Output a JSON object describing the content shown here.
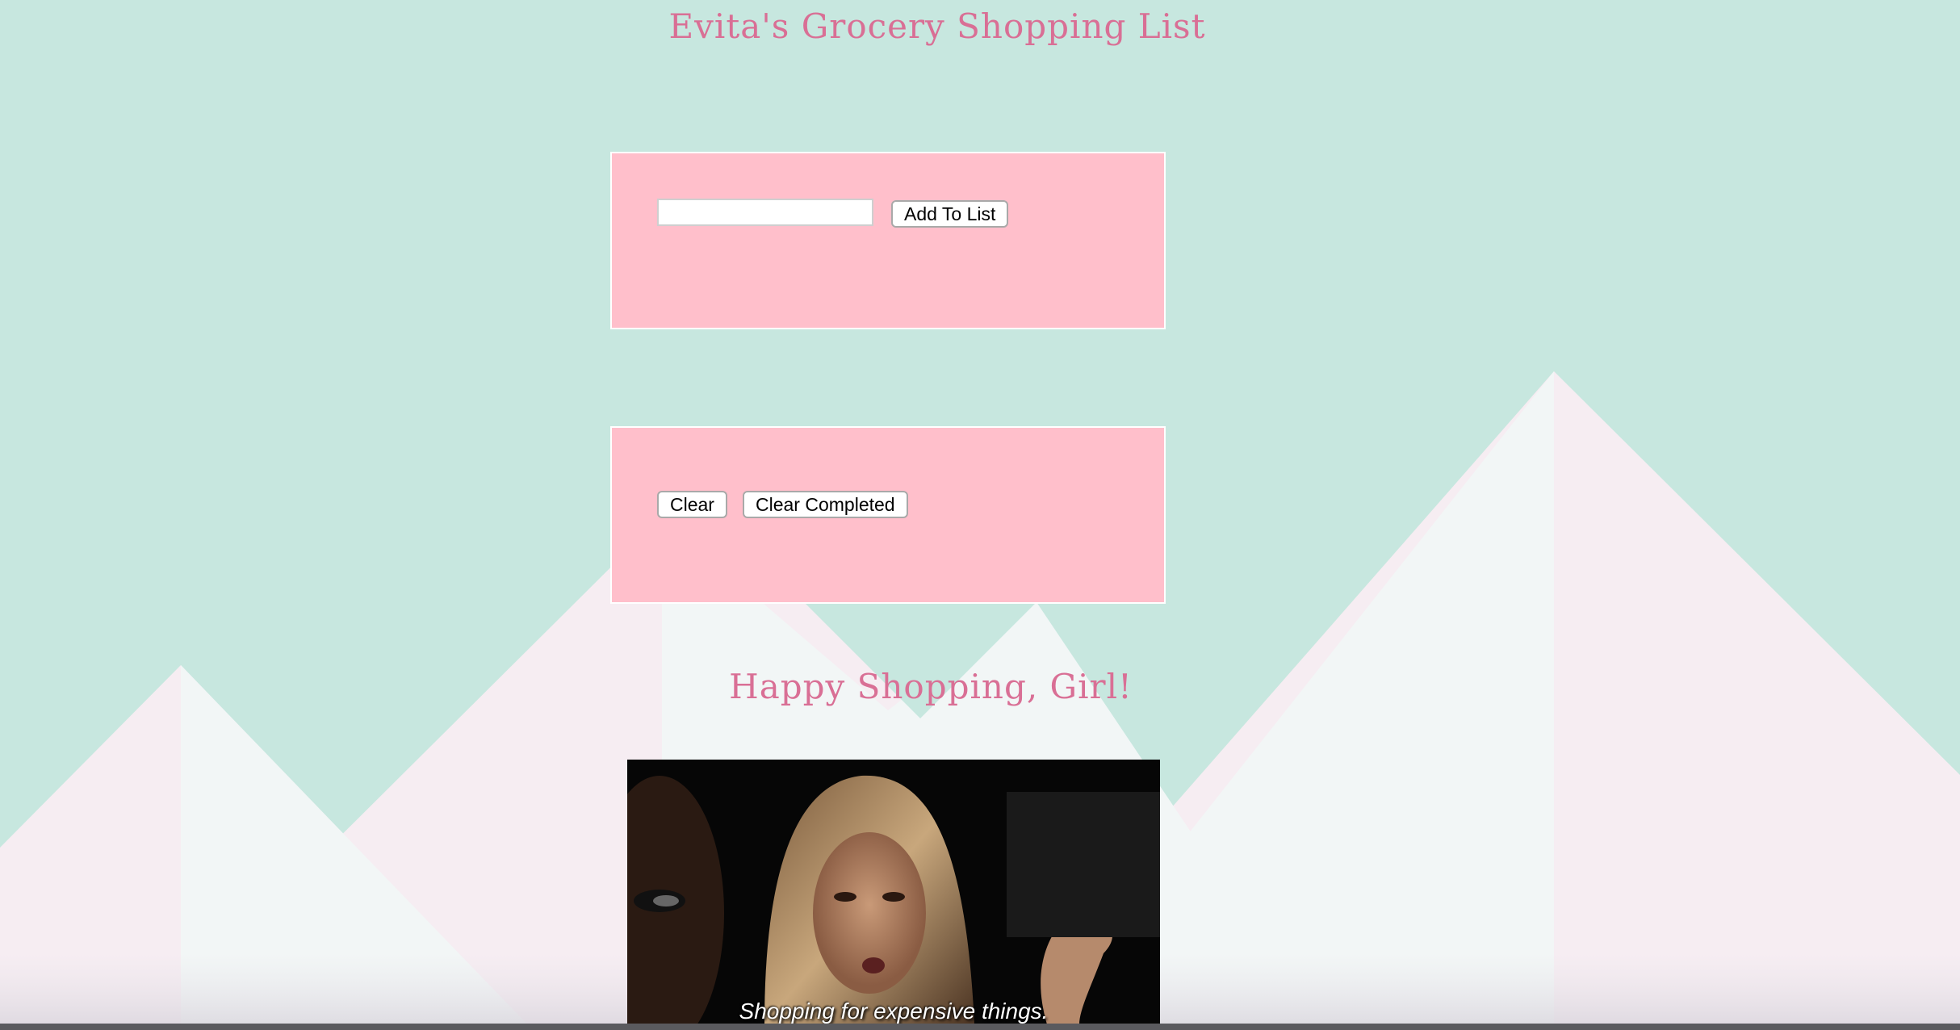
{
  "page": {
    "title": "Evita's Grocery Shopping List",
    "footer_message": "Happy Shopping, Girl!"
  },
  "add_panel": {
    "input_value": "",
    "input_placeholder": "",
    "add_button_label": "Add To List"
  },
  "clear_panel": {
    "clear_button_label": "Clear",
    "clear_completed_button_label": "Clear Completed"
  },
  "gif": {
    "caption": "Shopping for expensive things."
  },
  "colors": {
    "background": "#c7e7df",
    "panel": "#ffbfcb",
    "title_text": "#d96f95",
    "mountain_pink": "#f6edf2",
    "mountain_white": "#f2f6f6"
  }
}
